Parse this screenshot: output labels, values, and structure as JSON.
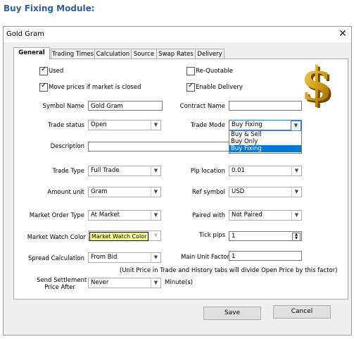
{
  "page_heading": "Buy Fixing Module:",
  "window": {
    "title": "Gold Gram"
  },
  "tabs": [
    {
      "label": "General"
    },
    {
      "label": "Trading Times"
    },
    {
      "label": "Calculation"
    },
    {
      "label": "Source"
    },
    {
      "label": "Swap Rates"
    },
    {
      "label": "Delivery"
    }
  ],
  "checkboxes": {
    "used": {
      "label": "Used",
      "checked": true
    },
    "re_quotable": {
      "label": "Re-Quotable",
      "checked": false
    },
    "move_prices": {
      "label": "Move prices if market is closed",
      "checked": true
    },
    "enable_delivery": {
      "label": "Enable Delivery",
      "checked": true
    }
  },
  "fields": {
    "symbol_name": {
      "label": "Symbol Name",
      "value": "Gold Gram"
    },
    "contract_name": {
      "label": "Contract Name",
      "value": ""
    },
    "trade_status": {
      "label": "Trade status",
      "value": "Open"
    },
    "trade_mode": {
      "label": "Trade Mode",
      "value": "Buy Fixing",
      "options": [
        "Buy & Sell",
        "Buy Only",
        "Buy Fixing"
      ],
      "selected": "Buy Fixing"
    },
    "description": {
      "label": "Description",
      "value": ""
    },
    "trade_type": {
      "label": "Trade Type",
      "value": "Full Trade"
    },
    "pip_location": {
      "label": "Pip location",
      "value": "0.01"
    },
    "amount_unit": {
      "label": "Amount unit",
      "value": "Gram"
    },
    "ref_symbol": {
      "label": "Ref symbol",
      "value": "USD"
    },
    "market_order_type": {
      "label": "Market Order Type",
      "value": "At Market"
    },
    "paired_with": {
      "label": "Paired with",
      "value": "Not Paired"
    },
    "market_watch_color": {
      "label": "Market Watch Color",
      "value": "Market Watch Color",
      "swatch_color": "#ffff99"
    },
    "tick_pips": {
      "label": "Tick pips",
      "value": "1"
    },
    "spread_calculation": {
      "label": "Spread Calculation",
      "value": "From Bid"
    },
    "main_unit_factor": {
      "label": "Main Unit Factor",
      "value": "1"
    },
    "send_settlement": {
      "label_line1": "Send Settlement",
      "label_line2": "Price After",
      "value": "Never",
      "suffix": "Minute(s)"
    }
  },
  "note": "(Unit Price in Trade and History tabs will divide Open Price by this factor)",
  "buttons": {
    "save": "Save",
    "cancel": "Cancel"
  },
  "icons": {
    "logo": "dollar-sign-icon",
    "close": "close-icon",
    "dropdown": "chevron-down-icon"
  },
  "colors": {
    "heading": "#2e5e9e",
    "selection": "#0078d7",
    "logo_gold": "#d4a017"
  }
}
